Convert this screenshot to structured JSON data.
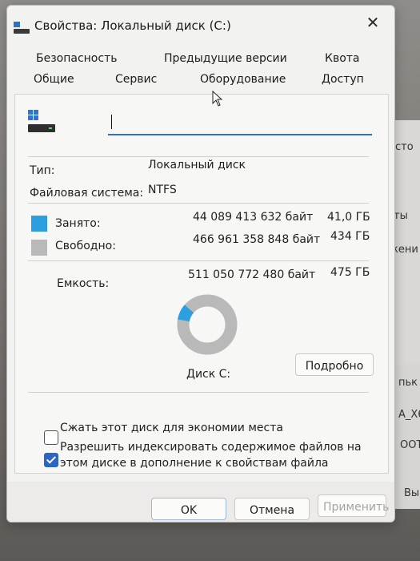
{
  "window": {
    "title": "Свойства: Локальный диск (C:)",
    "close_glyph": "✕"
  },
  "tabs": {
    "row1": [
      "Безопасность",
      "Предыдущие версии",
      "Квота"
    ],
    "row2": [
      "Общие",
      "Сервис",
      "Оборудование",
      "Доступ"
    ],
    "active": "Общие"
  },
  "general": {
    "name_value": "",
    "type_label": "Тип:",
    "type_value": "Локальный диск",
    "fs_label": "Файловая система:",
    "fs_value": "NTFS",
    "used_label": "Занято:",
    "used_bytes": "44 089 413 632 байт",
    "used_size": "41,0 ГБ",
    "used_fraction": 0.086,
    "free_label": "Свободно:",
    "free_bytes": "466 961 358 848 байт",
    "free_size": "434 ГБ",
    "capacity_label": "Емкость:",
    "capacity_bytes": "511 050 772 480 байт",
    "capacity_size": "475 ГБ",
    "drive_caption": "Диск C:",
    "details_button": "Подробно",
    "compress_label": "Сжать этот диск для экономии места",
    "compress_checked": false,
    "index_label": "Разрешить индексировать содержимое файлов на этом диске в дополнение к свойствам файла",
    "index_checked": true
  },
  "colors": {
    "used": "#2b9fe0",
    "free": "#b9b9b9",
    "accent": "#2a66c2"
  },
  "footer": {
    "ok": "OK",
    "cancel": "Отмена",
    "apply": "Применить"
  },
  "background": {
    "labels": [
      "сто",
      "ты",
      "кени",
      "пьк",
      "A_X6",
      "ООТ",
      "Вы"
    ]
  }
}
